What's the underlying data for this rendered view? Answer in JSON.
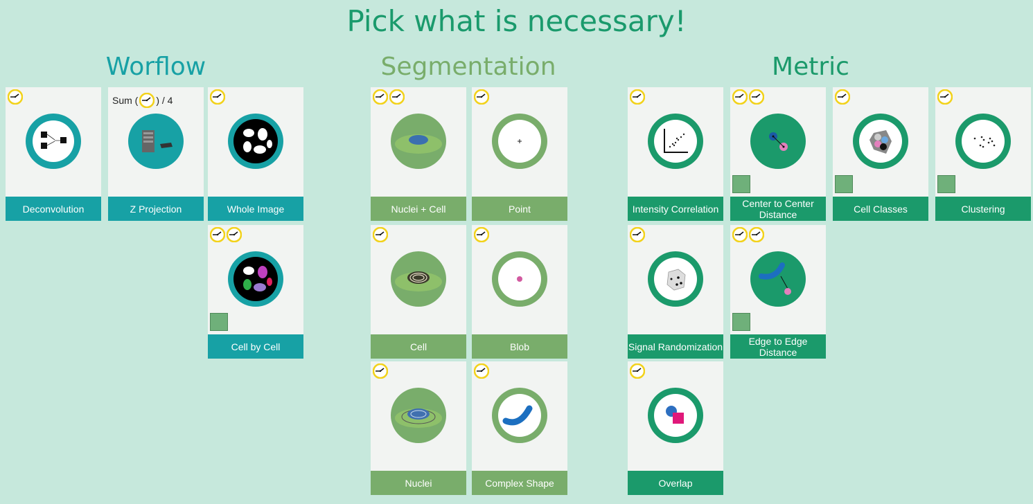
{
  "page": {
    "title": "Pick what is necessary!"
  },
  "sections": [
    {
      "title": "Worflow",
      "color": "#17a1a5"
    },
    {
      "title": "Segmentation",
      "color": "#79ad6b"
    },
    {
      "title": "Metric",
      "color": "#1b9a6b"
    }
  ],
  "workflow": [
    {
      "label": "Deconvolution",
      "clocks": 1
    },
    {
      "label": "Z Projection",
      "formula_prefix": "Sum (",
      "formula_suffix": ") / 4"
    },
    {
      "label": "Whole Image",
      "clocks": 1
    },
    {
      "label": "Cell by Cell",
      "clocks": 2,
      "badge": true
    }
  ],
  "segmentation": [
    {
      "label": "Nuclei + Cell",
      "clocks": 2
    },
    {
      "label": "Point",
      "clocks": 1
    },
    {
      "label": "Cell",
      "clocks": 1
    },
    {
      "label": "Blob",
      "clocks": 1
    },
    {
      "label": "Nuclei",
      "clocks": 1
    },
    {
      "label": "Complex Shape",
      "clocks": 1
    }
  ],
  "metric": [
    {
      "label": "Intensity Correlation",
      "clocks": 1
    },
    {
      "label": "Center to Center Distance",
      "clocks": 2,
      "badge": true
    },
    {
      "label": "Cell Classes",
      "clocks": 1,
      "badge": true
    },
    {
      "label": "Clustering",
      "clocks": 1,
      "badge": true
    },
    {
      "label": "Signal Randomization",
      "clocks": 1
    },
    {
      "label": "Edge to Edge Distance",
      "clocks": 2,
      "badge": true
    },
    {
      "label": "Overlap",
      "clocks": 1
    }
  ],
  "icons": {
    "clock": "clock-icon",
    "badge": "analysis-badge-icon"
  },
  "colors": {
    "background": "#c6e8dc",
    "title": "#1a9a6c",
    "workflow": "#17a1a5",
    "segmentation": "#79ad6b",
    "metric": "#1b9a6b",
    "clock_ring": "#f2d21b"
  }
}
